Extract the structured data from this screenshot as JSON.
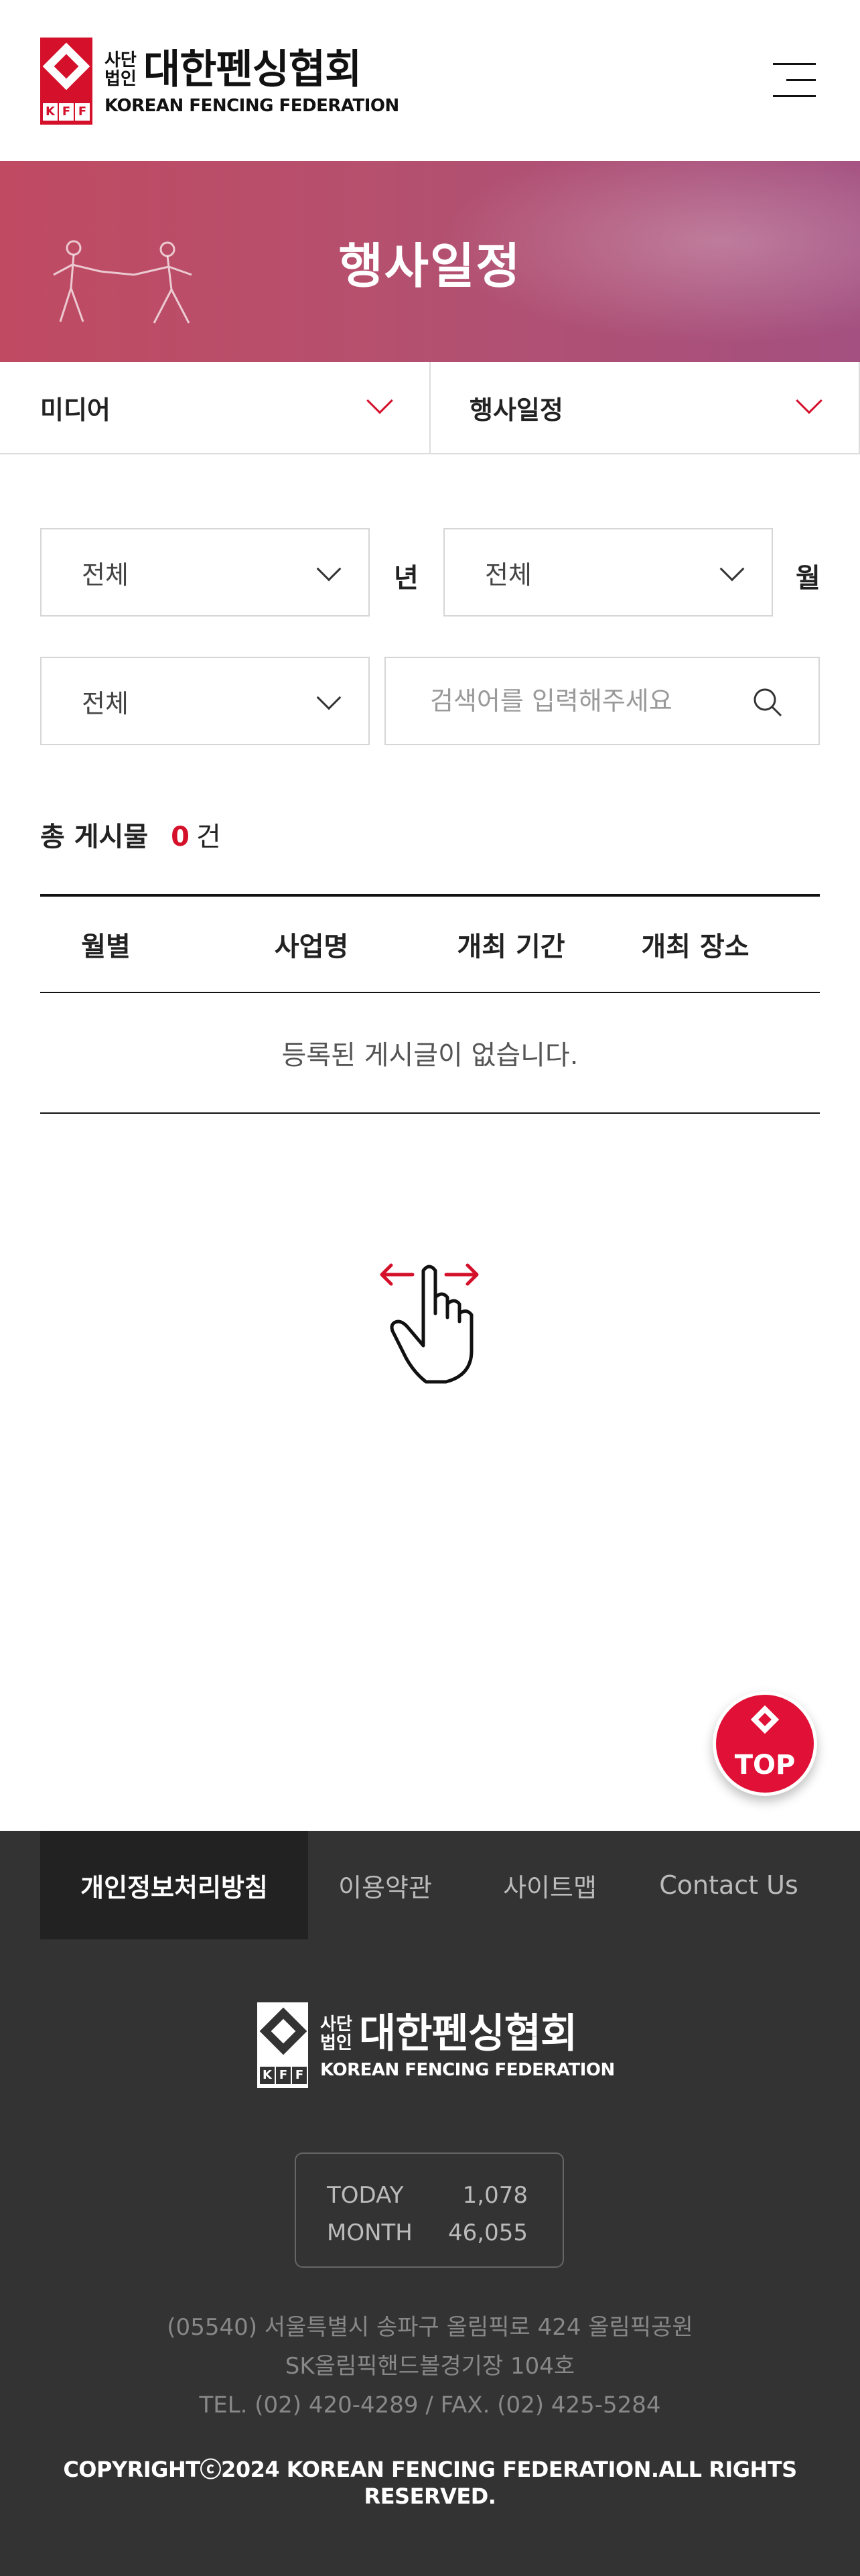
{
  "header": {
    "logo": {
      "corp": "사단법인",
      "corp_line1": "사단",
      "corp_line2": "법인",
      "name": "대한펜싱협회",
      "eng": "KOREAN FENCING FEDERATION",
      "badge": [
        "K",
        "F",
        "F"
      ]
    },
    "menu_icon": "hamburger-menu-icon"
  },
  "banner": {
    "title": "행사일정"
  },
  "subnav": {
    "items": [
      {
        "label": "미디어"
      },
      {
        "label": "행사일정"
      }
    ]
  },
  "filters": {
    "year_select": "전체",
    "year_unit": "년",
    "month_select": "전체",
    "month_unit": "월",
    "category_select": "전체",
    "search_placeholder": "검색어를 입력해주세요"
  },
  "count": {
    "label": "총 게시물",
    "value": "0",
    "unit": "건"
  },
  "table": {
    "columns": [
      "월별",
      "사업명",
      "개최 기간",
      "개최 장소"
    ],
    "empty_message": "등록된 게시글이 없습니다."
  },
  "top_button": {
    "label": "TOP"
  },
  "footer": {
    "links": [
      {
        "label": "개인정보처리방침",
        "active": true
      },
      {
        "label": "이용약관",
        "active": false
      },
      {
        "label": "사이트맵",
        "active": false
      },
      {
        "label": "Contact Us",
        "active": false
      }
    ],
    "counter": {
      "today_label": "TODAY",
      "today_value": "1,078",
      "month_label": "MONTH",
      "month_value": "46,055"
    },
    "address_lines": [
      "(05540) 서울특별시 송파구 올림픽로 424 올림픽공원",
      "SK올림픽핸드볼경기장 104호",
      "TEL. (02) 420-4289 / FAX. (02) 425-5284"
    ],
    "copyright": "COPYRIGHTⓒ2024 KOREAN FENCING FEDERATION.ALL RIGHTS RESERVED."
  },
  "colors": {
    "accent": "#d4102b",
    "footer_bg": "#333333"
  }
}
